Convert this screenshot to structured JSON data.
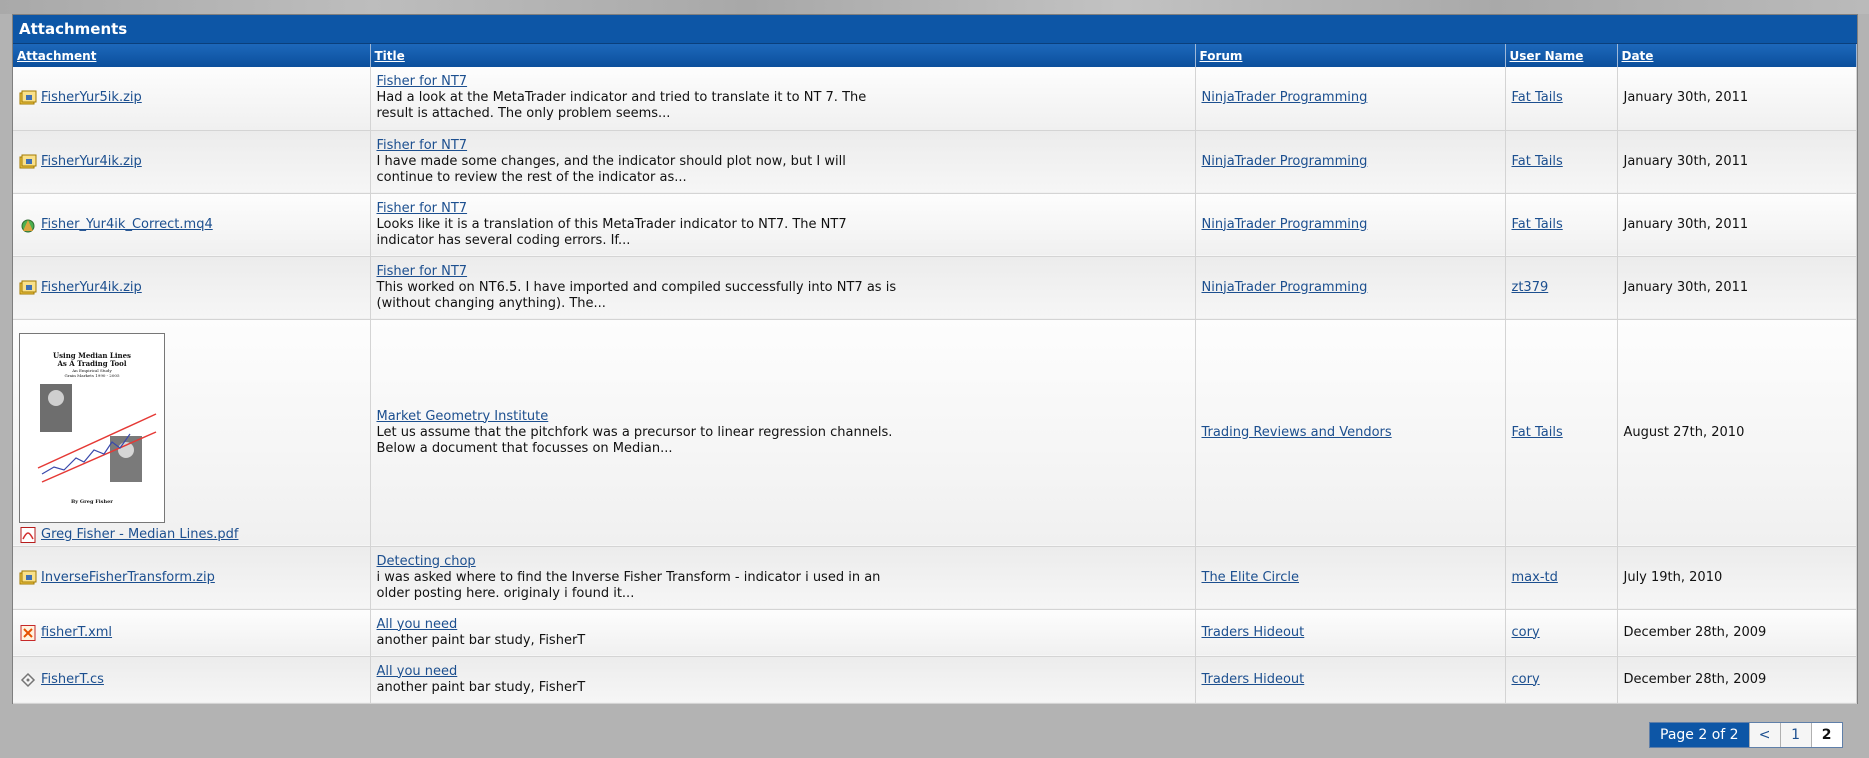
{
  "panel": {
    "title": "Attachments"
  },
  "columns": {
    "attachment": "Attachment",
    "title": "Title",
    "forum": "Forum",
    "user": "User Name",
    "date": "Date"
  },
  "rows": [
    {
      "icon": "zip-icon",
      "file": "FisherYur5ik.zip",
      "title": "Fisher for NT7",
      "snippet": "Had a look at the MetaTrader indicator and tried to translate it to NT 7. The result is attached. The only problem seems...",
      "forum": "NinjaTrader Programming",
      "user": "Fat Tails",
      "date": "January 30th, 2011"
    },
    {
      "icon": "zip-icon",
      "file": "FisherYur4ik.zip",
      "title": "Fisher for NT7",
      "snippet": "I have made some changes, and the indicator should plot now, but I will continue to review the rest of the indicator as...",
      "forum": "NinjaTrader Programming",
      "user": "Fat Tails",
      "date": "January 30th, 2011"
    },
    {
      "icon": "mq4-icon",
      "file": "Fisher_Yur4ik_Correct.mq4",
      "title": "Fisher for NT7",
      "snippet": "Looks like it is a translation of this MetaTrader indicator to NT7. The NT7 indicator has several coding errors. If...",
      "forum": "NinjaTrader Programming",
      "user": "Fat Tails",
      "date": "January 30th, 2011"
    },
    {
      "icon": "zip-icon",
      "file": "FisherYur4ik.zip",
      "title": "Fisher for NT7",
      "snippet": "This worked on NT6.5. I have imported and compiled successfully into NT7 as is (without changing anything). The...",
      "forum": "NinjaTrader Programming",
      "user": "zt379",
      "date": "January 30th, 2011"
    },
    {
      "icon": "pdf-icon",
      "file": "Greg Fisher - Median Lines.pdf",
      "title": "Market Geometry Institute",
      "snippet": "Let us assume that the pitchfork was a precursor to linear regression channels. Below a document that focusses on Median...",
      "forum": "Trading Reviews and Vendors",
      "user": "Fat Tails",
      "date": "August 27th, 2010",
      "thumb": {
        "line1": "Using Median Lines",
        "line2": "As A Trading Tool",
        "line3": "An Empirical Study",
        "line4": "Grain Markets 1990 - 2005",
        "by": "By Greg Fisher"
      }
    },
    {
      "icon": "zip-icon",
      "file": "InverseFisherTransform.zip",
      "title": "Detecting chop",
      "snippet": "i was asked where to find the Inverse Fisher Transform - indicator i used in an older posting here. originaly i found it...",
      "forum": "The Elite Circle",
      "user": "max-td",
      "date": "July 19th, 2010"
    },
    {
      "icon": "xml-icon",
      "file": "fisherT.xml",
      "title": "All you need",
      "snippet": "another paint bar study, FisherT",
      "forum": "Traders Hideout",
      "user": "cory",
      "date": "December 28th, 2009"
    },
    {
      "icon": "cs-icon",
      "file": "FisherT.cs",
      "title": "All you need",
      "snippet": "another paint bar study, FisherT",
      "forum": "Traders Hideout",
      "user": "cory",
      "date": "December 28th, 2009"
    }
  ],
  "pager": {
    "label": "Page 2 of 2",
    "prev": "<",
    "page1": "1",
    "page2": "2"
  },
  "colors": {
    "header_blue": "#0d56a6",
    "link": "#1c4f8f"
  }
}
